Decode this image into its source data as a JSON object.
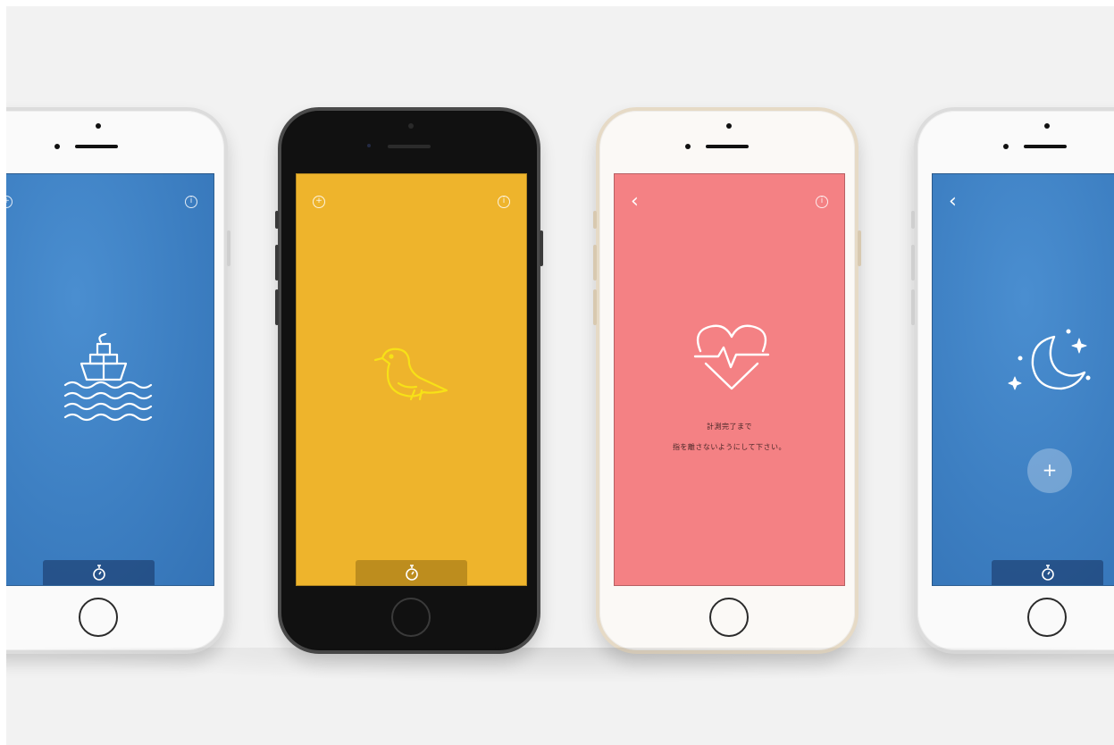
{
  "phones": [
    {
      "id": "phone-1",
      "frame": "white",
      "screen_color": "#3d7fc2",
      "center_icon": "ship-on-waves-icon",
      "top_right_icon": "info-icon",
      "bottom_tab_icon": "stopwatch-icon"
    },
    {
      "id": "phone-2",
      "frame": "black",
      "screen_color": "#eeb42c",
      "center_icon": "bird-icon",
      "top_left_icon": "add-icon",
      "top_right_icon": "info-icon",
      "bottom_tab_icon": "stopwatch-icon"
    },
    {
      "id": "phone-3",
      "frame": "gold",
      "screen_color": "#f48184",
      "center_icon": "heartbeat-icon",
      "top_left_icon": "back-chevron-icon",
      "top_right_icon": "info-icon",
      "message_line_1": "計測完了まで",
      "message_line_2": "指を離さないようにして下さい。"
    },
    {
      "id": "phone-4",
      "frame": "white",
      "screen_color": "#3d7fc2",
      "center_icon": "moon-stars-icon",
      "top_left_icon": "back-chevron-icon",
      "plus_button_label": "+",
      "bottom_tab_icon": "stopwatch-icon"
    }
  ]
}
